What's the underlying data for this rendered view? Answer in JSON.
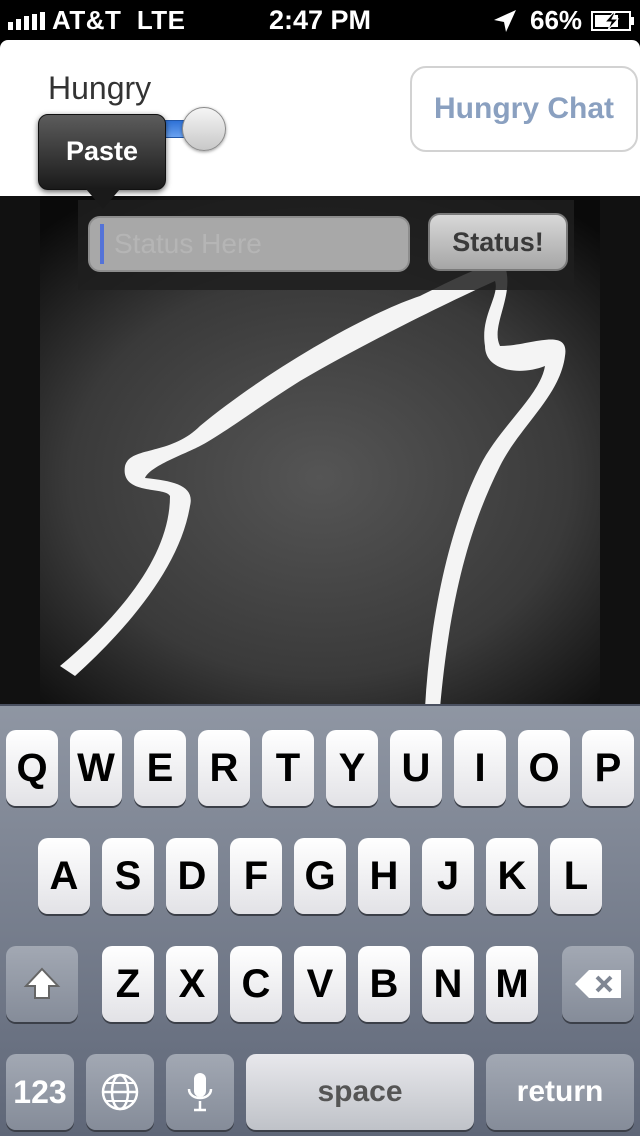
{
  "status_bar": {
    "carrier": "AT&T",
    "network": "LTE",
    "time": "2:47 PM",
    "battery": "66%",
    "icons": [
      "signal-bars-icon",
      "location-arrow-icon",
      "battery-charging-icon"
    ]
  },
  "header": {
    "toggle_label": "Hungry",
    "chat_button_label": "Hungry Chat"
  },
  "paste_menu": {
    "label": "Paste"
  },
  "status_form": {
    "placeholder": "Status Here",
    "button_label": "Status!"
  },
  "keyboard": {
    "row1": [
      "Q",
      "W",
      "E",
      "R",
      "T",
      "Y",
      "U",
      "I",
      "O",
      "P"
    ],
    "row2": [
      "A",
      "S",
      "D",
      "F",
      "G",
      "H",
      "J",
      "K",
      "L"
    ],
    "row3": [
      "Z",
      "X",
      "C",
      "V",
      "B",
      "N",
      "M"
    ],
    "numbers_label": "123",
    "space_label": "space",
    "return_label": "return",
    "icons": [
      "shift-icon",
      "backspace-icon",
      "globe-icon",
      "microphone-icon"
    ]
  },
  "colors": {
    "accent_blue": "#2f72d6",
    "chat_text": "#8aa0c0",
    "keyboard_bg": "#7d8595"
  }
}
